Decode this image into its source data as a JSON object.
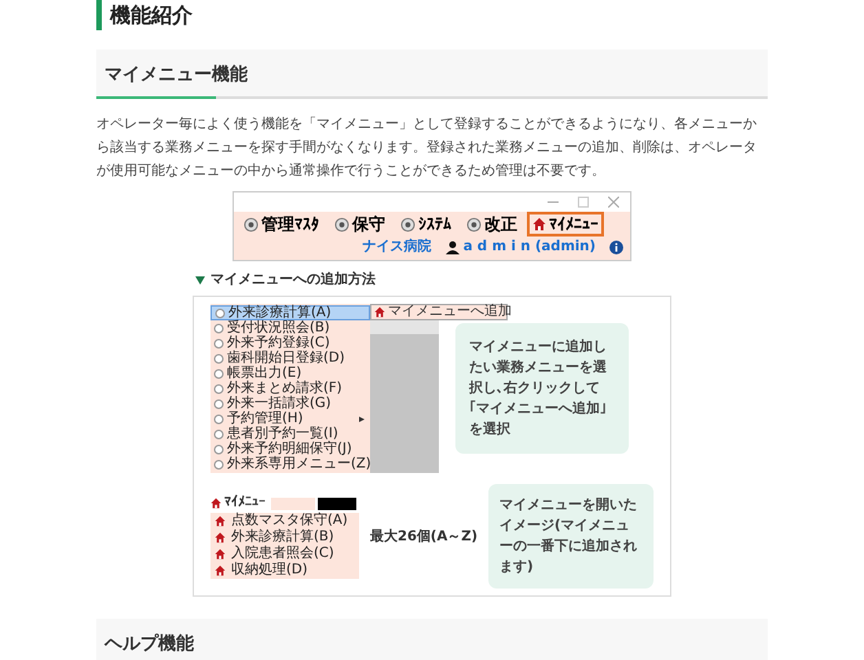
{
  "page_title": "機能紹介",
  "section": {
    "title": "マイメニュー機能",
    "body": "オペレーター毎によく使う機能を「マイメニュー」として登録することができるようになり、各メニューから該当する業務メニューを探す手間がなくなります。登録された業務メニューの追加、削除は、オペレータが使用可能なメニューの中から通常操作で行うことができるため管理は不要です。"
  },
  "app_window": {
    "toolbar": [
      {
        "label": "管理ﾏｽﾀ",
        "kind": "round",
        "selected": false
      },
      {
        "label": "保守",
        "kind": "round",
        "selected": false
      },
      {
        "label": "ｼｽﾃﾑ",
        "kind": "round",
        "selected": false
      },
      {
        "label": "改正",
        "kind": "round",
        "selected": false
      },
      {
        "label": "ﾏｲﾒﾆｭｰ",
        "kind": "house",
        "selected": true
      }
    ],
    "hospital": "ナイス病院",
    "user": "a d m i n (admin)"
  },
  "howto": {
    "title": "マイメニューへの追加方法",
    "menu": [
      {
        "label": "外来診療計算(A)",
        "selected": true,
        "submenu": false
      },
      {
        "label": "受付状況照会(B)",
        "selected": false,
        "submenu": false
      },
      {
        "label": "外来予約登録(C)",
        "selected": false,
        "submenu": false
      },
      {
        "label": "歯科開始日登録(D)",
        "selected": false,
        "submenu": false
      },
      {
        "label": "帳票出力(E)",
        "selected": false,
        "submenu": false
      },
      {
        "label": "外来まとめ請求(F)",
        "selected": false,
        "submenu": false
      },
      {
        "label": "外来一括請求(G)",
        "selected": false,
        "submenu": false
      },
      {
        "label": "予約管理(H)",
        "selected": false,
        "submenu": true
      },
      {
        "label": "患者別予約一覧(I)",
        "selected": false,
        "submenu": false
      },
      {
        "label": "外来予約明細保守(J)",
        "selected": false,
        "submenu": false
      },
      {
        "label": "外来系専用メニュー(Z)",
        "selected": false,
        "submenu": false
      }
    ],
    "context_item": "マイメニューへ追加",
    "note1": "マイメニューに追加したい業務メニューを選択し､右クリックして｢マイメニューへ追加｣を選択",
    "my_menu_label": "ﾏｲﾒﾆｭｰ",
    "my_menu": [
      "点数マスタ保守(A)",
      "外来診療計算(B)",
      "入院患者照会(C)",
      "収納処理(D)"
    ],
    "limit": "最大26個(A～Z)",
    "note2": "マイメニューを開いたイメージ(マイメニューの一番下に追加されます)"
  },
  "next_section": {
    "title": "ヘルプ機能"
  }
}
